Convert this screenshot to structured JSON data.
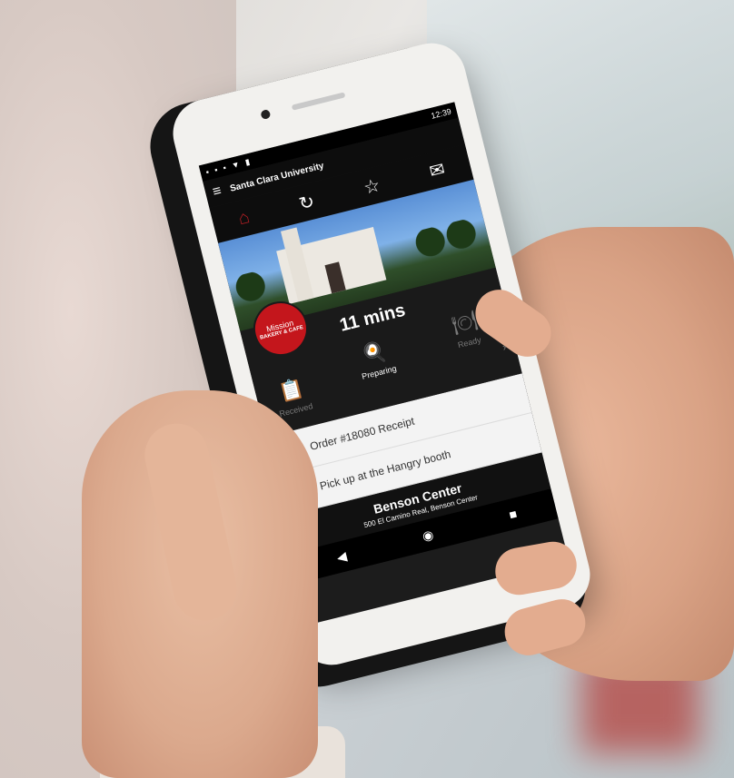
{
  "status_bar": {
    "time": "12:39",
    "icons": "▪ ▪ ▪ ▼ ▮"
  },
  "app_bar": {
    "menu_icon": "menu-icon",
    "title": "Santa Clara University"
  },
  "toolbar": {
    "icons": [
      "home-icon",
      "refresh-icon",
      "star-icon",
      "mail-icon"
    ]
  },
  "badge": {
    "line1": "Mission",
    "line2": "BAKERY & CAFE"
  },
  "order_status": {
    "eta": "11 mins",
    "steps": [
      {
        "label": "Received",
        "state": "done"
      },
      {
        "label": "Preparing",
        "state": "active"
      },
      {
        "label": "Ready",
        "state": "pending"
      }
    ]
  },
  "rows": [
    {
      "icon": "receipt-icon",
      "label": "Order #18080 Receipt"
    },
    {
      "icon": "megaphone-icon",
      "label": "Pick up at the Hangry booth"
    }
  ],
  "location": {
    "name": "Benson Center",
    "address": "500 El Camino Real, Benson Center"
  },
  "navbar": {
    "icons": [
      "back-icon",
      "home-nav-icon",
      "recents-icon"
    ]
  },
  "colors": {
    "accent": "#c4161c",
    "dark": "#1a1a1a",
    "light_row": "#f3f3f3"
  }
}
